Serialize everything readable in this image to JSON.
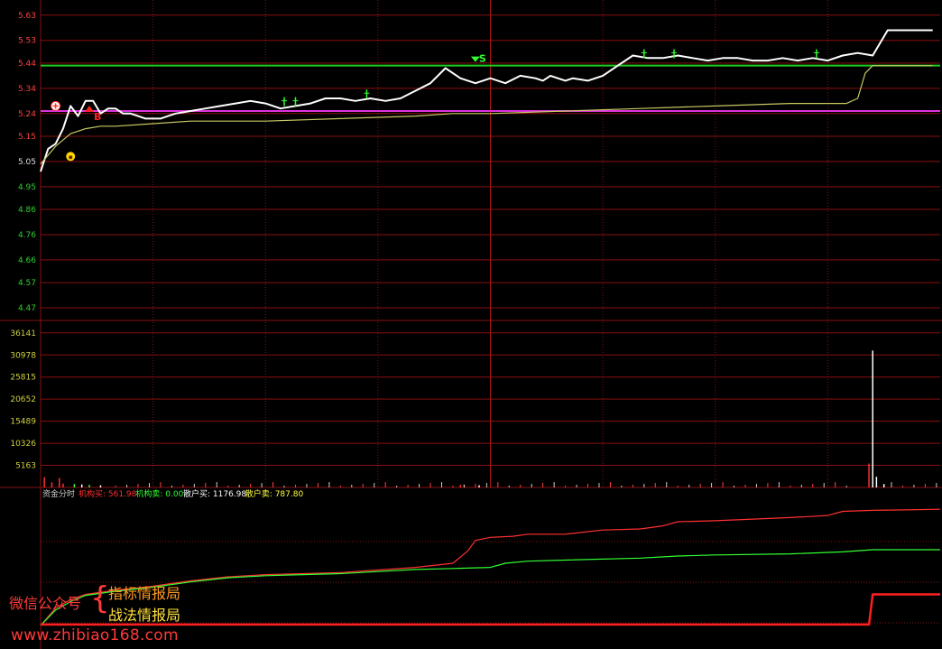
{
  "chart_data": [
    {
      "type": "line",
      "panel": "price",
      "ylim": [
        4.42,
        5.69
      ],
      "y_ticks": [
        "5.63",
        "5.53",
        "5.44",
        "5.34",
        "5.24",
        "5.15",
        "5.05",
        "4.95",
        "4.86",
        "4.76",
        "4.66",
        "4.57",
        "4.47"
      ],
      "y_tick_values": [
        5.63,
        5.53,
        5.44,
        5.34,
        5.24,
        5.15,
        5.05,
        4.95,
        4.86,
        4.76,
        4.66,
        4.57,
        4.47
      ],
      "x_range": [
        0,
        240
      ],
      "series": [
        {
          "role": "price",
          "color": "#ffffff",
          "x": [
            0,
            2,
            4,
            6,
            8,
            10,
            12,
            14,
            16,
            18,
            20,
            22,
            24,
            26,
            28,
            30,
            32,
            34,
            36,
            40,
            44,
            48,
            52,
            56,
            60,
            64,
            68,
            72,
            76,
            80,
            84,
            88,
            92,
            96,
            100,
            104,
            108,
            112,
            116,
            120,
            124,
            128,
            132,
            134,
            136,
            138,
            140,
            142,
            146,
            150,
            154,
            158,
            162,
            166,
            170,
            174,
            178,
            182,
            186,
            190,
            194,
            198,
            202,
            206,
            210,
            214,
            218,
            222,
            226,
            230,
            234,
            238
          ],
          "y": [
            5.01,
            5.1,
            5.12,
            5.18,
            5.27,
            5.23,
            5.29,
            5.29,
            5.24,
            5.26,
            5.26,
            5.24,
            5.24,
            5.23,
            5.22,
            5.22,
            5.22,
            5.23,
            5.24,
            5.25,
            5.26,
            5.27,
            5.28,
            5.29,
            5.28,
            5.26,
            5.27,
            5.28,
            5.3,
            5.3,
            5.29,
            5.3,
            5.29,
            5.3,
            5.33,
            5.36,
            5.42,
            5.38,
            5.36,
            5.38,
            5.36,
            5.39,
            5.38,
            5.37,
            5.39,
            5.38,
            5.37,
            5.38,
            5.37,
            5.39,
            5.43,
            5.47,
            5.46,
            5.46,
            5.47,
            5.46,
            5.45,
            5.46,
            5.46,
            5.45,
            5.45,
            5.46,
            5.45,
            5.46,
            5.45,
            5.47,
            5.48,
            5.47,
            5.57,
            5.57,
            5.57,
            5.57
          ]
        },
        {
          "role": "average",
          "color": "#c8c864",
          "x": [
            0,
            4,
            8,
            12,
            16,
            20,
            30,
            40,
            60,
            80,
            100,
            110,
            120,
            140,
            160,
            180,
            200,
            215,
            218,
            220,
            222,
            238
          ],
          "y": [
            5.04,
            5.11,
            5.16,
            5.18,
            5.19,
            5.19,
            5.2,
            5.21,
            5.21,
            5.22,
            5.23,
            5.24,
            5.24,
            5.25,
            5.26,
            5.27,
            5.28,
            5.28,
            5.3,
            5.4,
            5.43,
            5.43
          ]
        }
      ],
      "hlines": [
        {
          "value": 5.43,
          "color": "#22cc22"
        },
        {
          "value": 5.25,
          "color": "#dd33dd"
        }
      ],
      "markers": [
        {
          "type": "pattern",
          "x": 4,
          "y": 5.27,
          "color": "#ffffff"
        },
        {
          "type": "face",
          "x": 8,
          "y": 5.07,
          "color": "#ffd400"
        },
        {
          "type": "buy",
          "x": 13,
          "y": 5.25,
          "text": "B",
          "color": "#ff2020"
        },
        {
          "type": "sell",
          "x": 116,
          "y": 5.43,
          "text": "S",
          "color": "#30ff30"
        },
        {
          "type": "tick",
          "x": 65,
          "y": 5.28,
          "color": "#30ff30"
        },
        {
          "type": "tick",
          "x": 68,
          "y": 5.28,
          "color": "#30ff30"
        },
        {
          "type": "tick",
          "x": 87,
          "y": 5.31,
          "color": "#30ff30"
        },
        {
          "type": "tick",
          "x": 161,
          "y": 5.47,
          "color": "#30ff30"
        },
        {
          "type": "tick",
          "x": 169,
          "y": 5.47,
          "color": "#30ff30"
        },
        {
          "type": "tick",
          "x": 207,
          "y": 5.47,
          "color": "#30ff30"
        }
      ]
    },
    {
      "type": "bar",
      "panel": "volume",
      "ylim": [
        0,
        38000
      ],
      "y_ticks": [
        "36141",
        "30978",
        "25815",
        "20652",
        "15489",
        "10326",
        "5163"
      ],
      "y_tick_values": [
        36141,
        30978,
        25815,
        20652,
        15489,
        10326,
        5163
      ],
      "bars": [
        {
          "x": 1,
          "value": 2400,
          "color": "#ff3030"
        },
        {
          "x": 3,
          "value": 1200,
          "color": "#ff3030"
        },
        {
          "x": 5,
          "value": 2200,
          "color": "#ff3030"
        },
        {
          "x": 6,
          "value": 900,
          "color": "#ff3030"
        },
        {
          "x": 9,
          "value": 800,
          "color": "#33ff33"
        },
        {
          "x": 11,
          "value": 700,
          "color": "#ffffff"
        },
        {
          "x": 13,
          "value": 600,
          "color": "#33ff33"
        },
        {
          "x": 16,
          "value": 500,
          "color": "#ffffff"
        },
        {
          "x": 112,
          "value": 600,
          "color": "#ff3030"
        },
        {
          "x": 113,
          "value": 700,
          "color": "#ff3030"
        },
        {
          "x": 117,
          "value": 500,
          "color": "#ffffff"
        },
        {
          "x": 221,
          "value": 5600,
          "color": "#ff3030"
        },
        {
          "x": 222,
          "value": 32000,
          "color": "#ffffff"
        },
        {
          "x": 223,
          "value": 2500,
          "color": "#ffffff"
        },
        {
          "x": 225,
          "value": 800,
          "color": "#ffffff"
        }
      ]
    },
    {
      "type": "line",
      "panel": "capital",
      "legend": {
        "title": "资金分时",
        "items": [
          {
            "label": "机构买: 561.98",
            "color": "#ff3030"
          },
          {
            "label": "机构卖: 0.00",
            "color": "#33ff33"
          },
          {
            "label": "散户买: 1176.98",
            "color": "#ffffff"
          },
          {
            "label": "散户卖: 787.80",
            "color": "#ffff40"
          }
        ]
      },
      "ylim": [
        0,
        1200
      ],
      "series": [
        {
          "role": "retail-buy",
          "color": "#ff3030",
          "x": [
            0,
            4,
            8,
            12,
            20,
            30,
            40,
            50,
            60,
            70,
            80,
            100,
            110,
            114,
            116,
            120,
            126,
            130,
            140,
            150,
            160,
            166,
            170,
            180,
            200,
            210,
            214,
            222,
            240
          ],
          "y": [
            0,
            170,
            250,
            300,
            340,
            380,
            430,
            470,
            490,
            500,
            510,
            560,
            600,
            720,
            820,
            850,
            860,
            880,
            880,
            920,
            930,
            960,
            1000,
            1010,
            1040,
            1060,
            1100,
            1110,
            1120
          ]
        },
        {
          "role": "retail-sell",
          "color": "#33ff33",
          "x": [
            0,
            4,
            8,
            12,
            20,
            30,
            40,
            50,
            60,
            70,
            80,
            100,
            110,
            120,
            124,
            130,
            140,
            160,
            170,
            180,
            200,
            214,
            222,
            240
          ],
          "y": [
            0,
            150,
            230,
            290,
            330,
            370,
            420,
            460,
            480,
            490,
            500,
            540,
            550,
            560,
            600,
            620,
            630,
            650,
            670,
            680,
            690,
            710,
            730,
            730
          ]
        },
        {
          "role": "institution-buy",
          "color": "#ff2020",
          "x": [
            0,
            221,
            222,
            240
          ],
          "y": [
            10,
            10,
            300,
            300
          ]
        }
      ]
    }
  ],
  "watermark": {
    "left": "微信公众号",
    "brace": "{",
    "right_top": "指标情报局",
    "right_bottom": "战法情报局",
    "url": "www.zhibiao168.com"
  },
  "colors": {
    "grid_red": "#8a0f0f",
    "tick_red": "#ff4040",
    "tick_green": "#30d030",
    "tick_yellow": "#d0d040"
  }
}
